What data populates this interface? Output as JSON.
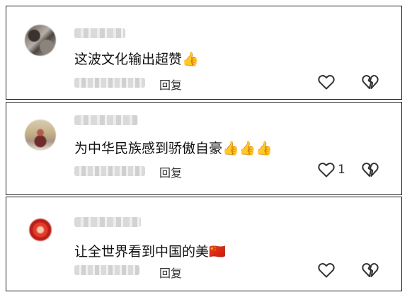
{
  "comments": [
    {
      "text": "这波文化输出超赞",
      "emoji": "👍",
      "reply_label": "回复",
      "like_count": ""
    },
    {
      "text": "为中华民族感到骄傲自豪",
      "emoji": "👍👍👍",
      "reply_label": "回复",
      "like_count": "1"
    },
    {
      "text": "让全世界看到中国的美",
      "emoji": "🇨🇳",
      "reply_label": "回复",
      "like_count": ""
    }
  ],
  "icons": {
    "like": "heart-outline-icon",
    "dislike": "broken-heart-icon"
  },
  "colors": {
    "border": "#222222",
    "text": "#111111",
    "secondary_text": "#333333"
  }
}
